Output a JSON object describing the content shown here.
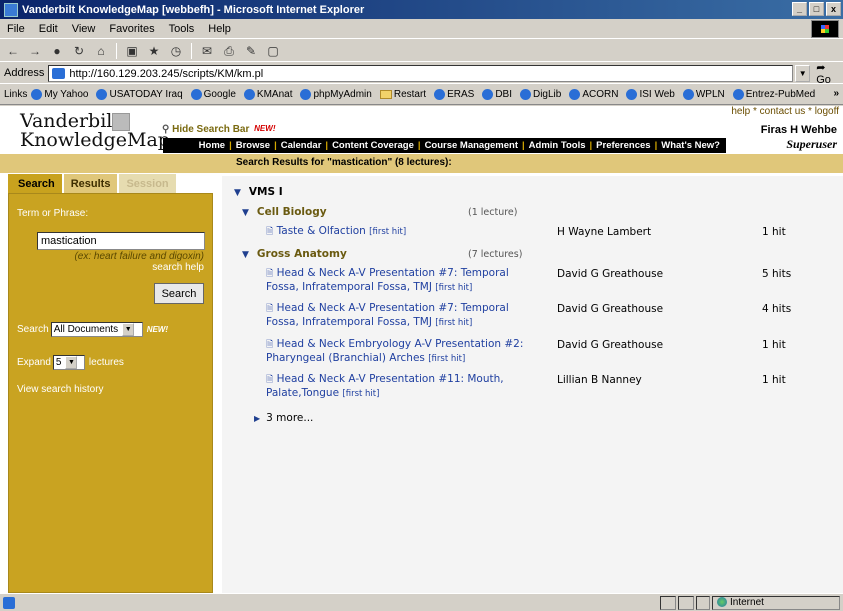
{
  "window": {
    "title": "Vanderbilt KnowledgeMap [webbefh] - Microsoft Internet Explorer",
    "min": "_",
    "max": "□",
    "close": "x"
  },
  "menu": [
    "File",
    "Edit",
    "View",
    "Favorites",
    "Tools",
    "Help"
  ],
  "address": {
    "label": "Address",
    "url": "http://160.129.203.245/scripts/KM/km.pl",
    "go": "Go"
  },
  "links": {
    "label": "Links",
    "items": [
      "My Yahoo",
      "USATODAY Iraq",
      "Google",
      "KMAnat",
      "phpMyAdmin",
      "Restart",
      "ERAS",
      "DBI",
      "DigLib",
      "ACORN",
      "ISI Web",
      "WPLN",
      "Entrez-PubMed"
    ]
  },
  "site": {
    "logo_line1": "Vanderbilt",
    "logo_line2": "KnowledgeMap",
    "hide_search": "Hide Search Bar",
    "new_badge": "NEW!",
    "top_links": "help * contact us * logoff",
    "user_name": "Firas H Wehbe",
    "user_role": "Superuser",
    "nav": [
      "Home",
      "Browse",
      "Calendar",
      "Content Coverage",
      "Course Management",
      "Admin Tools",
      "Preferences",
      "What's New?"
    ],
    "results_title": "Search Results for \"mastication\" (8 lectures):"
  },
  "sidebar": {
    "tabs": [
      "Search",
      "Results",
      "Session"
    ],
    "term_label": "Term or Phrase:",
    "term_value": "mastication",
    "hint": "(ex: heart failure and digoxin)",
    "help": "search help",
    "search_button": "Search",
    "search_label": "Search",
    "search_scope": "All Documents",
    "scope_new": "NEW!",
    "expand_label": "Expand",
    "expand_value": "5",
    "expand_suffix": "lectures",
    "history": "View search history"
  },
  "results": {
    "group": "VMS I",
    "categories": [
      {
        "name": "Cell Biology",
        "count": "(1 lecture)",
        "items": [
          {
            "title": "Taste & Olfaction",
            "first_hit": "[first hit]",
            "author": "H Wayne Lambert",
            "hits": "1 hit"
          }
        ]
      },
      {
        "name": "Gross Anatomy",
        "count": "(7 lectures)",
        "items": [
          {
            "title": "Head & Neck A-V Presentation #7: Temporal Fossa, Infratemporal Fossa, TMJ",
            "first_hit": "[first hit]",
            "author": "David G Greathouse",
            "hits": "5 hits"
          },
          {
            "title": "Head & Neck A-V Presentation #7: Temporal Fossa, Infratemporal Fossa, TMJ",
            "first_hit": "[first hit]",
            "author": "David G Greathouse",
            "hits": "4 hits"
          },
          {
            "title": "Head & Neck Embryology A-V Presentation #2: Pharyngeal (Branchial) Arches",
            "first_hit": "[first hit]",
            "author": "David G Greathouse",
            "hits": "1 hit"
          },
          {
            "title": "Head & Neck A-V Presentation #11: Mouth, Palate,Tongue",
            "first_hit": "[first hit]",
            "author": "Lillian B Nanney",
            "hits": "1 hit"
          }
        ]
      }
    ],
    "more": "3 more..."
  },
  "status": {
    "zone": "Internet"
  }
}
